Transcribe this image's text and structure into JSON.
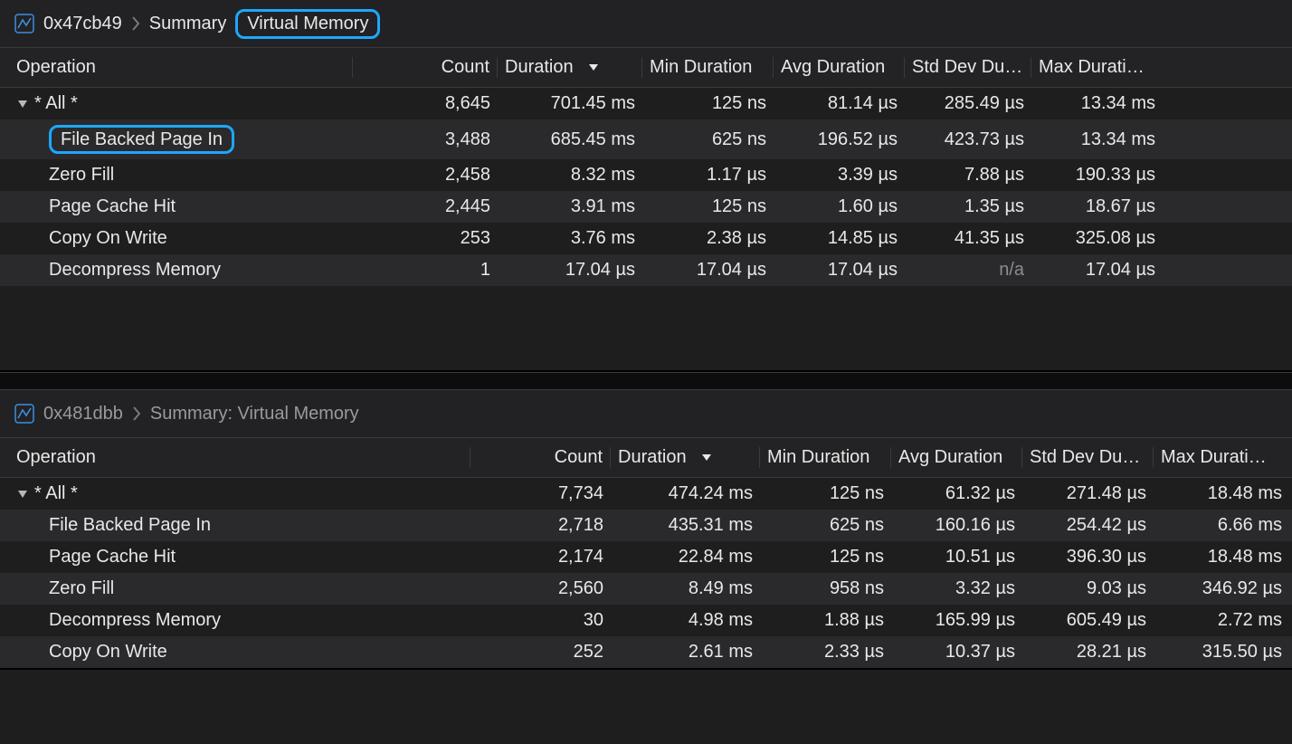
{
  "panel1": {
    "breadcrumb": {
      "address": "0x47cb49",
      "summary": "Summary",
      "vm": "Virtual Memory"
    },
    "columns": {
      "operation": "Operation",
      "count": "Count",
      "duration": "Duration",
      "min": "Min Duration",
      "avg": "Avg Duration",
      "std": "Std Dev Du…",
      "max": "Max Durati…"
    },
    "rows": {
      "all": {
        "name": "* All *",
        "count": "8,645",
        "dur": "701.45 ms",
        "min": "125 ns",
        "avg": "81.14 µs",
        "std": "285.49 µs",
        "max": "13.34 ms"
      },
      "fbpi": {
        "name": "File Backed Page In",
        "count": "3,488",
        "dur": "685.45 ms",
        "min": "625 ns",
        "avg": "196.52 µs",
        "std": "423.73 µs",
        "max": "13.34 ms"
      },
      "zero": {
        "name": "Zero Fill",
        "count": "2,458",
        "dur": "8.32 ms",
        "min": "1.17 µs",
        "avg": "3.39 µs",
        "std": "7.88 µs",
        "max": "190.33 µs"
      },
      "pch": {
        "name": "Page Cache Hit",
        "count": "2,445",
        "dur": "3.91 ms",
        "min": "125 ns",
        "avg": "1.60 µs",
        "std": "1.35 µs",
        "max": "18.67 µs"
      },
      "cow": {
        "name": "Copy On Write",
        "count": "253",
        "dur": "3.76 ms",
        "min": "2.38 µs",
        "avg": "14.85 µs",
        "std": "41.35 µs",
        "max": "325.08 µs"
      },
      "decomp": {
        "name": "Decompress Memory",
        "count": "1",
        "dur": "17.04 µs",
        "min": "17.04 µs",
        "avg": "17.04 µs",
        "std": "n/a",
        "max": "17.04 µs"
      }
    }
  },
  "panel2": {
    "breadcrumb": {
      "address": "0x481dbb",
      "summary": "Summary: Virtual Memory"
    },
    "columns": {
      "operation": "Operation",
      "count": "Count",
      "duration": "Duration",
      "min": "Min Duration",
      "avg": "Avg Duration",
      "std": "Std Dev Du…",
      "max": "Max Durati…"
    },
    "rows": {
      "all": {
        "name": "* All *",
        "count": "7,734",
        "dur": "474.24 ms",
        "min": "125 ns",
        "avg": "61.32 µs",
        "std": "271.48 µs",
        "max": "18.48 ms"
      },
      "fbpi": {
        "name": "File Backed Page In",
        "count": "2,718",
        "dur": "435.31 ms",
        "min": "625 ns",
        "avg": "160.16 µs",
        "std": "254.42 µs",
        "max": "6.66 ms"
      },
      "pch": {
        "name": "Page Cache Hit",
        "count": "2,174",
        "dur": "22.84 ms",
        "min": "125 ns",
        "avg": "10.51 µs",
        "std": "396.30 µs",
        "max": "18.48 ms"
      },
      "zero": {
        "name": "Zero Fill",
        "count": "2,560",
        "dur": "8.49 ms",
        "min": "958 ns",
        "avg": "3.32 µs",
        "std": "9.03 µs",
        "max": "346.92 µs"
      },
      "decomp": {
        "name": "Decompress Memory",
        "count": "30",
        "dur": "4.98 ms",
        "min": "1.88 µs",
        "avg": "165.99 µs",
        "std": "605.49 µs",
        "max": "2.72 ms"
      },
      "cow": {
        "name": "Copy On Write",
        "count": "252",
        "dur": "2.61 ms",
        "min": "2.33 µs",
        "avg": "10.37 µs",
        "std": "28.21 µs",
        "max": "315.50 µs"
      }
    }
  }
}
